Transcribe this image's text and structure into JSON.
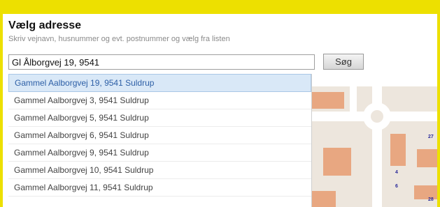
{
  "header": {
    "title": "Vælg adresse",
    "subtitle": "Skriv vejnavn, husnummer og evt. postnummer og vælg fra listen"
  },
  "search": {
    "value": "Gl Ålborgvej 19, 9541",
    "button_label": "Søg"
  },
  "suggestions": {
    "selected_index": 0,
    "items": [
      {
        "label": "Gammel Aalborgvej 19, 9541 Suldrup"
      },
      {
        "label": "Gammel Aalborgvej 3, 9541 Suldrup"
      },
      {
        "label": "Gammel Aalborgvej 5, 9541 Suldrup"
      },
      {
        "label": "Gammel Aalborgvej 6, 9541 Suldrup"
      },
      {
        "label": "Gammel Aalborgvej 9, 9541 Suldrup"
      },
      {
        "label": "Gammel Aalborgvej 10, 9541 Suldrup"
      },
      {
        "label": "Gammel Aalborgvej 11, 9541 Suldrup"
      }
    ]
  },
  "map": {
    "labels": [
      "27",
      "4",
      "6",
      "28"
    ]
  },
  "colors": {
    "outer_border": "#ede000",
    "selected_bg": "#d9e8f7",
    "selected_text": "#2d5fa6",
    "building": "#e8a781",
    "map_bg": "#ede6dd",
    "road": "#ffffff",
    "map_label": "#2a2a9a"
  }
}
